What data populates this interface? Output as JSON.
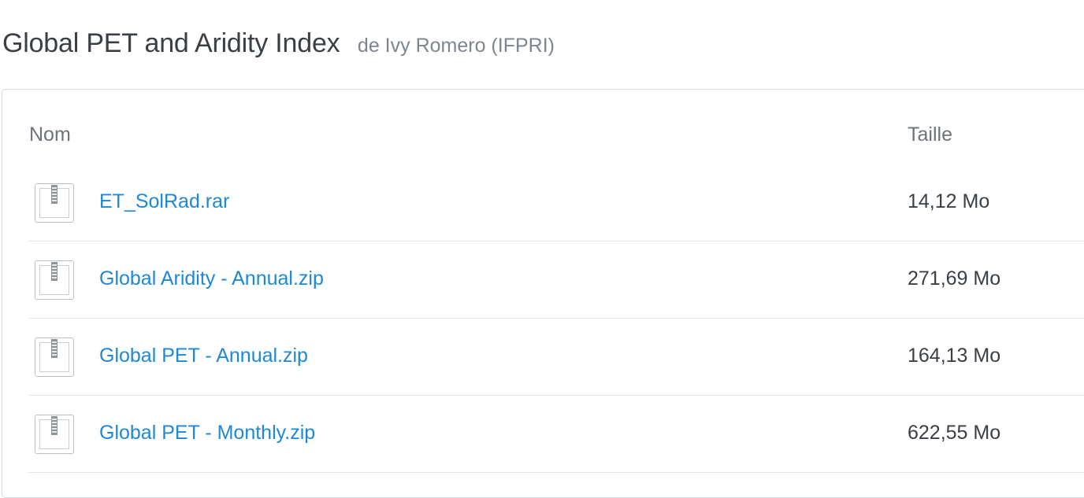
{
  "header": {
    "title": "Global PET and Aridity Index",
    "byline": "de Ivy Romero (IFPRI)"
  },
  "table": {
    "columns": {
      "name": "Nom",
      "size": "Taille"
    },
    "rows": [
      {
        "name": "ET_SolRad.rar",
        "size": "14,12 Mo",
        "icon": "archive-file-icon"
      },
      {
        "name": "Global Aridity - Annual.zip",
        "size": "271,69 Mo",
        "icon": "archive-file-icon"
      },
      {
        "name": "Global PET - Annual.zip",
        "size": "164,13 Mo",
        "icon": "archive-file-icon"
      },
      {
        "name": "Global PET - Monthly.zip",
        "size": "622,55 Mo",
        "icon": "archive-file-icon"
      }
    ]
  },
  "colors": {
    "link": "#1e88d6",
    "title": "#3a3f45",
    "muted": "#7d8690",
    "border": "#d3dbe3"
  }
}
